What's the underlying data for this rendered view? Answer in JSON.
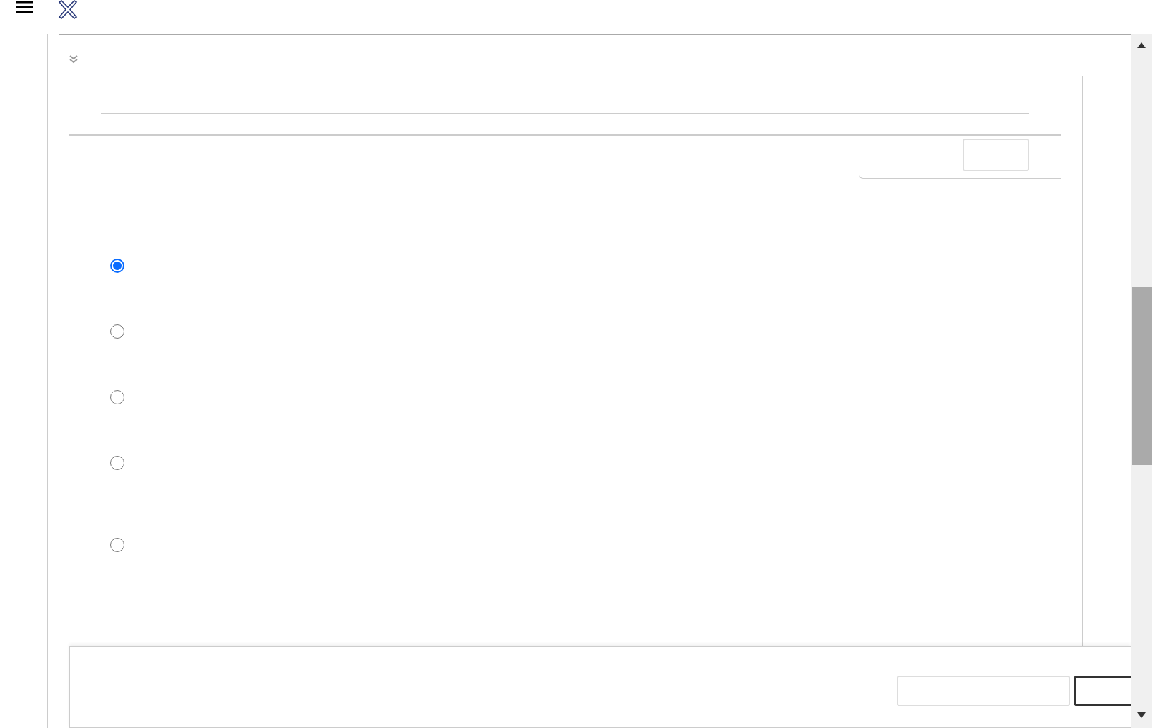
{
  "options": [
    {
      "selected": true
    },
    {
      "selected": false
    },
    {
      "selected": false
    },
    {
      "selected": false
    },
    {
      "selected": false
    }
  ]
}
